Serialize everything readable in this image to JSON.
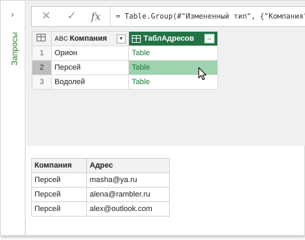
{
  "left_pane": {
    "title": "Запросы",
    "collapse_icon": "chevron-right-icon"
  },
  "formula_bar": {
    "cancel_icon": "close-icon",
    "confirm_icon": "check-icon",
    "fx_label": "fx",
    "formula": "= Table.Group(#\"Измененный тип\", {\"Компания\"}, {{\"ТаблАдресов\", each _, type table}})"
  },
  "grid": {
    "columns": [
      {
        "type_label": "ABC",
        "name": "Компания"
      },
      {
        "type_label": "table",
        "name": "ТаблАдресов"
      }
    ],
    "rows": [
      {
        "num": "1",
        "company": "Орион",
        "value": "Table"
      },
      {
        "num": "2",
        "company": "Персей",
        "value": "Table"
      },
      {
        "num": "3",
        "company": "Водолей",
        "value": "Table"
      }
    ],
    "accent_color": "#217346",
    "selected_cell_color": "#9fd3b0"
  },
  "data_table": {
    "headers": [
      "Компания",
      "Адрес"
    ],
    "rows": [
      [
        "Персей",
        "masha@ya.ru"
      ],
      [
        "Персей",
        "alena@rambler.ru"
      ],
      [
        "Персей",
        "alex@outlook.com"
      ]
    ]
  }
}
